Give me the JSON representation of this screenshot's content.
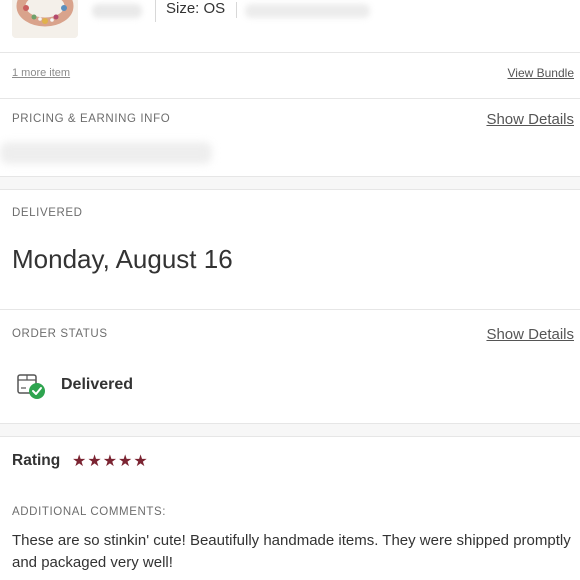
{
  "item": {
    "size_label": "Size: OS",
    "more_items_link": "1 more item",
    "view_bundle_link": "View Bundle"
  },
  "pricing": {
    "label": "PRICING & EARNING INFO",
    "show_details": "Show Details"
  },
  "delivered": {
    "label": "DELIVERED",
    "date": "Monday, August 16"
  },
  "order_status": {
    "label": "ORDER STATUS",
    "show_details": "Show Details",
    "status": "Delivered",
    "icon": "package-check-icon"
  },
  "rating": {
    "label": "Rating",
    "stars": "★★★★★",
    "value": 5,
    "max": 5,
    "star_color": "#7b2432"
  },
  "comments": {
    "label": "ADDITIONAL COMMENTS:",
    "text": "These are so stinkin' cute! Beautifully handmade items. They were shipped promptly and packaged very well!"
  }
}
